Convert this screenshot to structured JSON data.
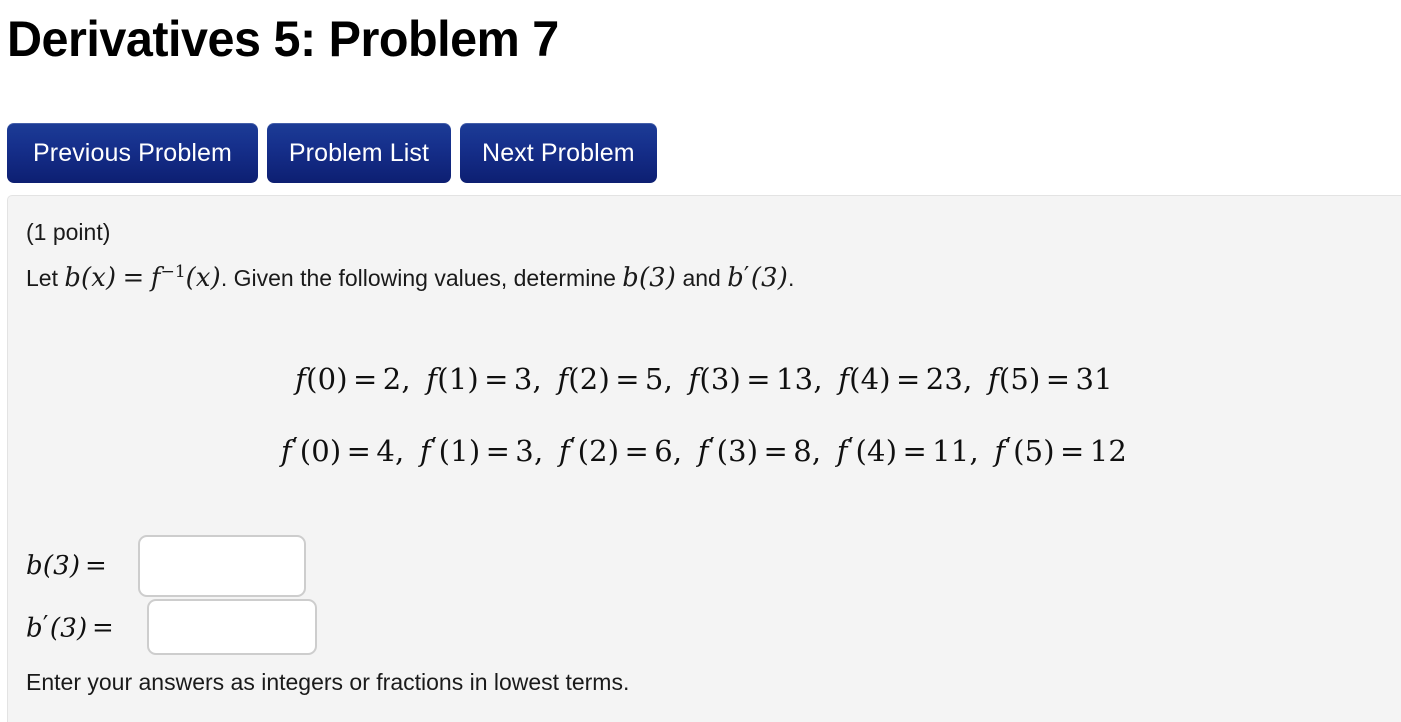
{
  "header": {
    "title": "Derivatives 5: Problem 7"
  },
  "nav": {
    "previous_label": "Previous Problem",
    "problem_list_label": "Problem List",
    "next_label": "Next Problem"
  },
  "problem": {
    "points": "(1 point)",
    "prompt": {
      "lead": "Let",
      "b_of_x": "b(x)",
      "equals": "=",
      "f_inverse": "f",
      "f_inverse_sup": "−1",
      "f_inverse_arg": "(x)",
      "middle": ". Given the following values, determine",
      "target_value": "b(3)",
      "conjunction": "and",
      "target_derivative_base": "b",
      "target_derivative_prime": "′",
      "target_derivative_arg": "(3)",
      "period": "."
    },
    "values": {
      "f": {
        "name": "f",
        "inputs": [
          0,
          1,
          2,
          3,
          4,
          5
        ],
        "outputs": [
          2,
          3,
          5,
          13,
          23,
          31
        ]
      },
      "f_prime": {
        "name": "f",
        "prime": "′",
        "inputs": [
          0,
          1,
          2,
          3,
          4,
          5
        ],
        "outputs": [
          4,
          3,
          6,
          8,
          11,
          12
        ]
      },
      "equals_sign": "=",
      "separator": ","
    },
    "answers": [
      {
        "label_base": "b",
        "label_prime": "",
        "label_arg": "(3)",
        "equals": "=",
        "value": "",
        "placeholder": ""
      },
      {
        "label_base": "b",
        "label_prime": "′",
        "label_arg": "(3)",
        "equals": "=",
        "value": "",
        "placeholder": ""
      }
    ],
    "hint": "Enter your answers as integers or fractions in lowest terms."
  },
  "colors": {
    "button_top": "#1c3c96",
    "button_bottom": "#0d1f72",
    "panel_bg": "#f4f4f4",
    "panel_border": "#e3e3e3",
    "input_border": "#cdcdcd",
    "text": "#1a1a1a"
  }
}
